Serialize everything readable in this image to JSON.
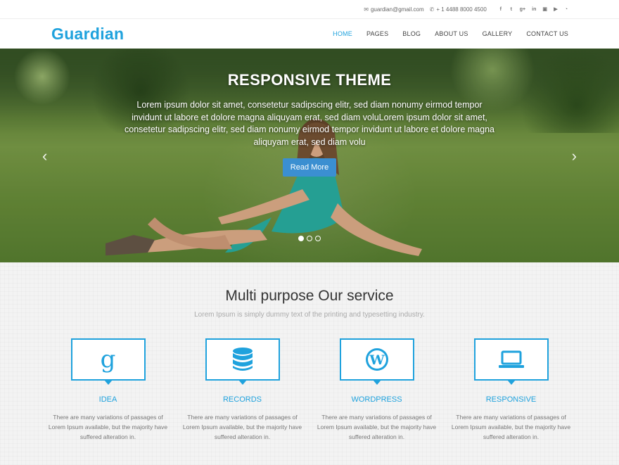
{
  "topbar": {
    "email": "guardian@gmail.com",
    "email_icon": "envelope-icon",
    "phone": "+ 1 4488 8000 4500",
    "phone_icon": "phone-icon",
    "social": [
      "facebook-icon",
      "twitter-icon",
      "google-plus-icon",
      "linkedin-icon",
      "flickr-icon",
      "youtube-icon",
      "rss-icon"
    ]
  },
  "header": {
    "logo": "Guardian",
    "brand_color": "#1fa2dd",
    "nav": [
      {
        "label": "HOME",
        "active": true
      },
      {
        "label": "PAGES",
        "active": false
      },
      {
        "label": "BLOG",
        "active": false
      },
      {
        "label": "ABOUT US",
        "active": false
      },
      {
        "label": "GALLERY",
        "active": false
      },
      {
        "label": "CONTACT US",
        "active": false
      }
    ]
  },
  "hero": {
    "title": "RESPONSIVE THEME",
    "text": "Lorem ipsum dolor sit amet, consetetur sadipscing elitr, sed diam nonumy eirmod tempor invidunt ut labore et dolore magna aliquyam erat, sed diam voluLorem ipsum dolor sit amet, consetetur sadipscing elitr, sed diam nonumy eirmod tempor invidunt ut labore et dolore magna aliquyam erat, sed diam volu",
    "button": "Read More",
    "button_color": "#3b8fd1",
    "slides": 3,
    "active_slide": 1
  },
  "services": {
    "title": "Multi purpose Our service",
    "subtitle": "Lorem Ipsum is simply dummy text of the printing and typesetting industry.",
    "items": [
      {
        "icon": "google-icon",
        "title": "IDEA",
        "text": "There are many variations of passages of Lorem Ipsum available, but the majority have suffered alteration in."
      },
      {
        "icon": "database-icon",
        "title": "RECORDS",
        "text": "There are many variations of passages of Lorem Ipsum available, but the majority have suffered alteration in."
      },
      {
        "icon": "wordpress-icon",
        "title": "WORDPRESS",
        "text": "There are many variations of passages of Lorem Ipsum available, but the majority have suffered alteration in."
      },
      {
        "icon": "laptop-icon",
        "title": "RESPONSIVE",
        "text": "There are many variations of passages of Lorem Ipsum available, but the majority have suffered alteration in."
      }
    ]
  }
}
